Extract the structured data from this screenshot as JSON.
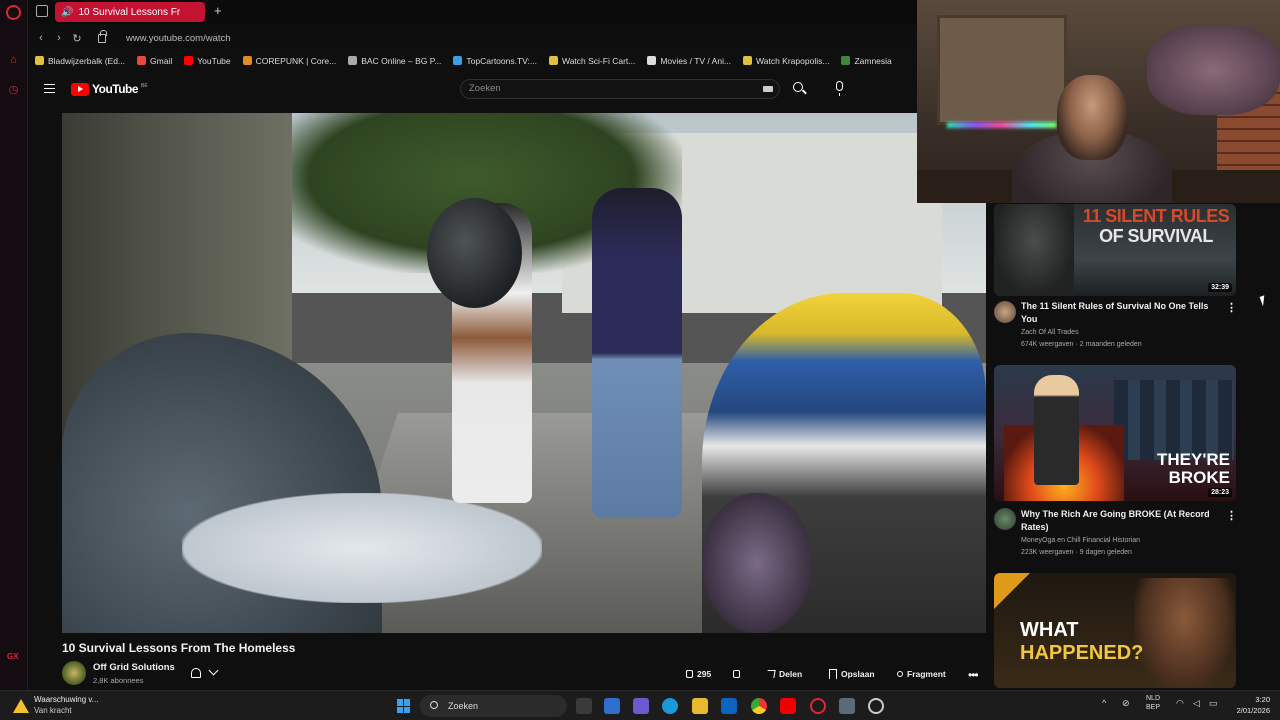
{
  "browser": {
    "tab_title": "10 Survival Lessons Fr",
    "url": "www.youtube.com/watch",
    "bookmarks": [
      {
        "label": "Bladwijzerbalk (Ed...",
        "color": "#e0c040"
      },
      {
        "label": "Gmail",
        "color": "#e84a3a"
      },
      {
        "label": "YouTube",
        "color": "#ff0000"
      },
      {
        "label": "COREPUNK | Core...",
        "color": "#e08a2a"
      },
      {
        "label": "BAC Online – BG P...",
        "color": "#aaaaaa"
      },
      {
        "label": "TopCartoons.TV:...",
        "color": "#3aa0e0"
      },
      {
        "label": "Watch Sci-Fi Cart...",
        "color": "#e0c040"
      },
      {
        "label": "Movies / TV / Ani...",
        "color": "#dddddd"
      },
      {
        "label": "Watch Krapopolis...",
        "color": "#e0c040"
      },
      {
        "label": "Zamnesia",
        "color": "#3a8a3a"
      }
    ],
    "sidebar_badge": "GX"
  },
  "youtube": {
    "logo_text": "YouTube",
    "logo_country": "BE",
    "search_placeholder": "Zoeken",
    "video": {
      "title": "10 Survival Lessons From The Homeless",
      "channel": "Off Grid Solutions",
      "subscribers": "2,8K abonnees",
      "likes": "295",
      "share_label": "Delen",
      "save_label": "Opslaan",
      "clip_label": "Fragment"
    },
    "recommendations": [
      {
        "title": "The 11 Silent Rules of Survival No One Tells You",
        "channel": "Zach Of All Trades",
        "meta": "674K weergaven · 2 maanden geleden",
        "duration": "32:39",
        "thumb_text_1": "11 SILENT RULES",
        "thumb_text_2": "OF SURVIVAL"
      },
      {
        "title": "Why The Rich Are Going BROKE (At Record Rates)",
        "channel": "MoneyOga en Chill Financial Historian",
        "meta": "223K weergaven · 9 dagen geleden",
        "duration": "28:23",
        "thumb_text_1": "THEY'RE",
        "thumb_text_2": "BROKE"
      },
      {
        "title": "",
        "channel": "",
        "meta": "",
        "duration": "",
        "thumb_text_1": "WHAT",
        "thumb_text_2": "HAPPENED?"
      }
    ]
  },
  "taskbar": {
    "notification_title": "Waarschuwing v...",
    "notification_sub": "Van kracht",
    "search_label": "Zoeken",
    "lang_1": "NLD",
    "lang_2": "BEP",
    "time": "3:20",
    "date": "2/01/2026"
  },
  "colors": {
    "accent": "#c41233",
    "youtube_red": "#ff0000",
    "background": "#0f0f0f"
  }
}
